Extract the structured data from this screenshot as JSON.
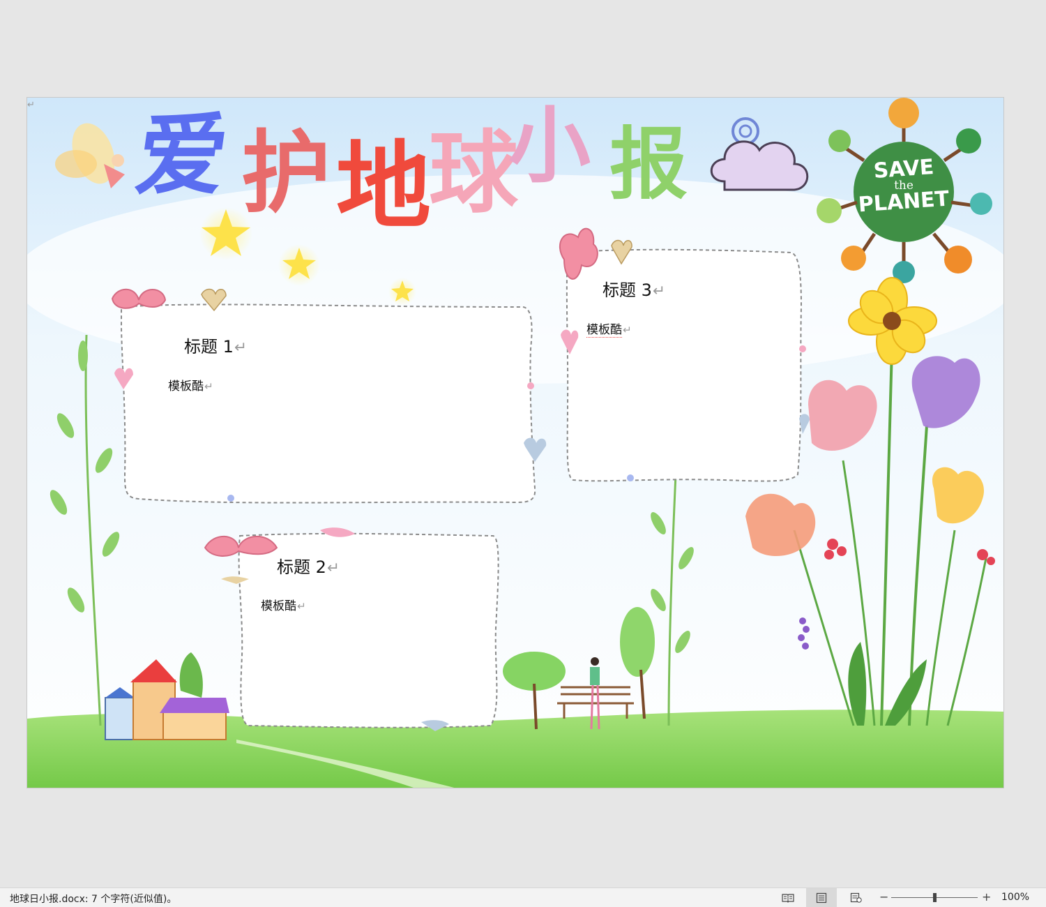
{
  "document": {
    "headline_chars": [
      {
        "char": "爱",
        "color": "#5a6ef0"
      },
      {
        "char": "护",
        "color": "#e86b6b"
      },
      {
        "char": "地",
        "color": "#f04a3c"
      },
      {
        "char": "球",
        "color": "#f5a6b8"
      },
      {
        "char": "小",
        "color": "#e9a3c6"
      },
      {
        "char": "报",
        "color": "#8fd16a"
      }
    ],
    "badge": {
      "line1": "SAVE",
      "line2": "the",
      "line3": "PLANET"
    },
    "frames": [
      {
        "title": "标题 1",
        "body": "模板酷"
      },
      {
        "title": "标题 2",
        "body": "模板酷"
      },
      {
        "title": "标题 3",
        "body": "模板酷"
      }
    ],
    "return_mark": "↵",
    "paragraph_mark": "↵"
  },
  "statusbar": {
    "doc_info": "地球日小报.docx: 7 个字符(近似值)。",
    "zoom_minus": "−",
    "zoom_plus": "+",
    "zoom_level": "100%",
    "view_buttons": [
      "read-mode-icon",
      "print-layout-icon",
      "web-layout-icon"
    ]
  },
  "colors": {
    "sky": "#dff0fb",
    "grass": "#8ed65a",
    "frame_border": "#8a8a8a",
    "badge_globe": "#3f8f45"
  }
}
